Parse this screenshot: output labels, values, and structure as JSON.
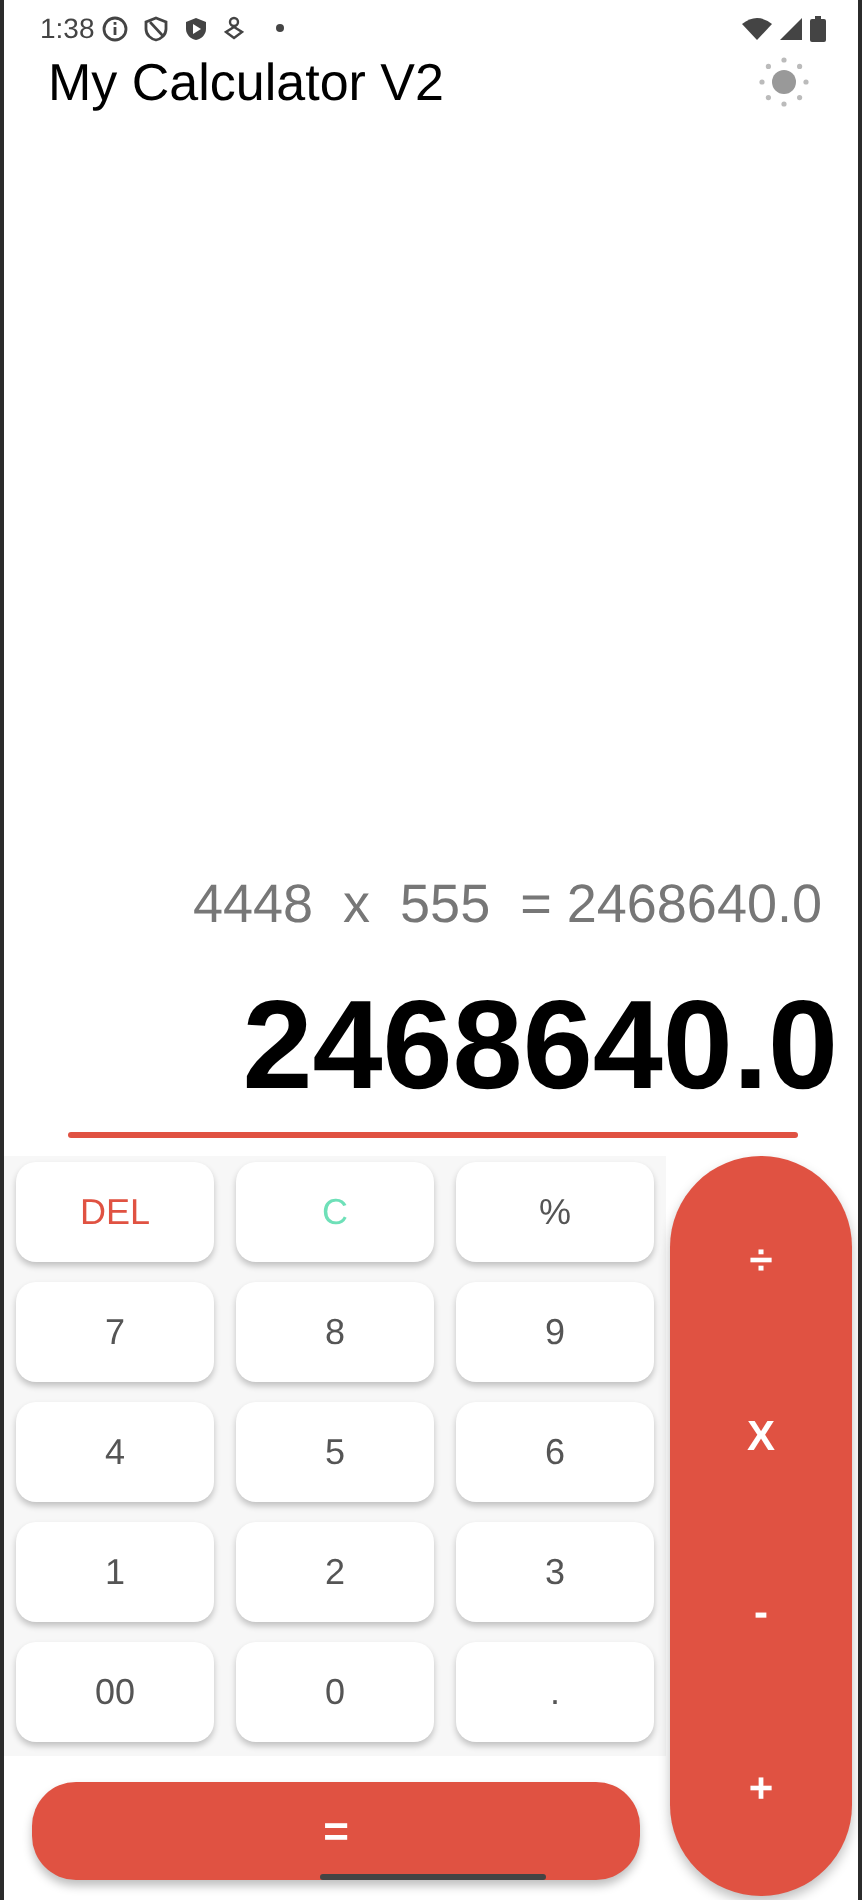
{
  "status_bar": {
    "time": "1:38"
  },
  "app_bar": {
    "title": "My Calculator V2"
  },
  "display": {
    "expression": "4448  x  555  = 2468640.0",
    "result": "2468640.0"
  },
  "keys": [
    {
      "label": "DEL",
      "kind": "delete"
    },
    {
      "label": "C",
      "kind": "clear"
    },
    {
      "label": "%",
      "kind": "plain"
    },
    {
      "label": "7",
      "kind": "plain"
    },
    {
      "label": "8",
      "kind": "plain"
    },
    {
      "label": "9",
      "kind": "plain"
    },
    {
      "label": "4",
      "kind": "plain"
    },
    {
      "label": "5",
      "kind": "plain"
    },
    {
      "label": "6",
      "kind": "plain"
    },
    {
      "label": "1",
      "kind": "plain"
    },
    {
      "label": "2",
      "kind": "plain"
    },
    {
      "label": "3",
      "kind": "plain"
    },
    {
      "label": "00",
      "kind": "plain"
    },
    {
      "label": "0",
      "kind": "plain"
    },
    {
      "label": ".",
      "kind": "plain"
    }
  ],
  "operators": [
    "÷",
    "X",
    "-",
    "+"
  ],
  "equals": "="
}
